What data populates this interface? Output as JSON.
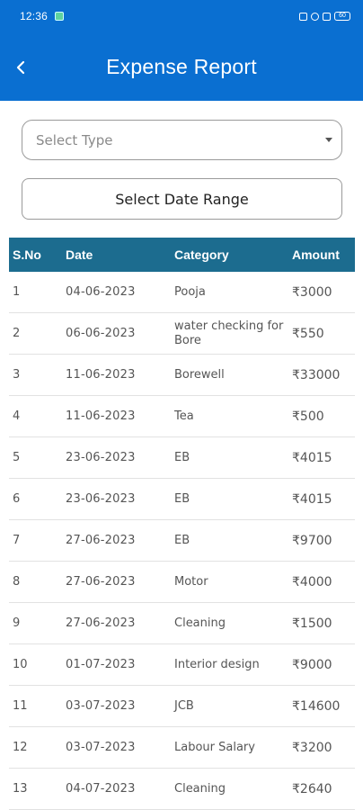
{
  "status_bar": {
    "time": "12:36",
    "battery": "60"
  },
  "app_bar": {
    "title": "Expense Report"
  },
  "filters": {
    "select_type_placeholder": "Select Type",
    "date_range_label": "Select Date Range"
  },
  "table": {
    "headers": [
      "S.No",
      "Date",
      "Category",
      "Amount"
    ],
    "rows": [
      {
        "sno": "1",
        "date": "04-06-2023",
        "category": "Pooja",
        "amount": "₹3000"
      },
      {
        "sno": "2",
        "date": "06-06-2023",
        "category": "water checking for Bore",
        "amount": "₹550"
      },
      {
        "sno": "3",
        "date": "11-06-2023",
        "category": "Borewell",
        "amount": "₹33000"
      },
      {
        "sno": "4",
        "date": "11-06-2023",
        "category": "Tea",
        "amount": "₹500"
      },
      {
        "sno": "5",
        "date": "23-06-2023",
        "category": "EB",
        "amount": "₹4015"
      },
      {
        "sno": "6",
        "date": "23-06-2023",
        "category": "EB",
        "amount": "₹4015"
      },
      {
        "sno": "7",
        "date": "27-06-2023",
        "category": "EB",
        "amount": "₹9700"
      },
      {
        "sno": "8",
        "date": "27-06-2023",
        "category": "Motor",
        "amount": "₹4000"
      },
      {
        "sno": "9",
        "date": "27-06-2023",
        "category": "Cleaning",
        "amount": "₹1500"
      },
      {
        "sno": "10",
        "date": "01-07-2023",
        "category": "Interior design",
        "amount": "₹9000"
      },
      {
        "sno": "11",
        "date": "03-07-2023",
        "category": "JCB",
        "amount": "₹14600"
      },
      {
        "sno": "12",
        "date": "03-07-2023",
        "category": "Labour Salary",
        "amount": "₹3200"
      },
      {
        "sno": "13",
        "date": "04-07-2023",
        "category": "Cleaning",
        "amount": "₹2640"
      }
    ]
  }
}
